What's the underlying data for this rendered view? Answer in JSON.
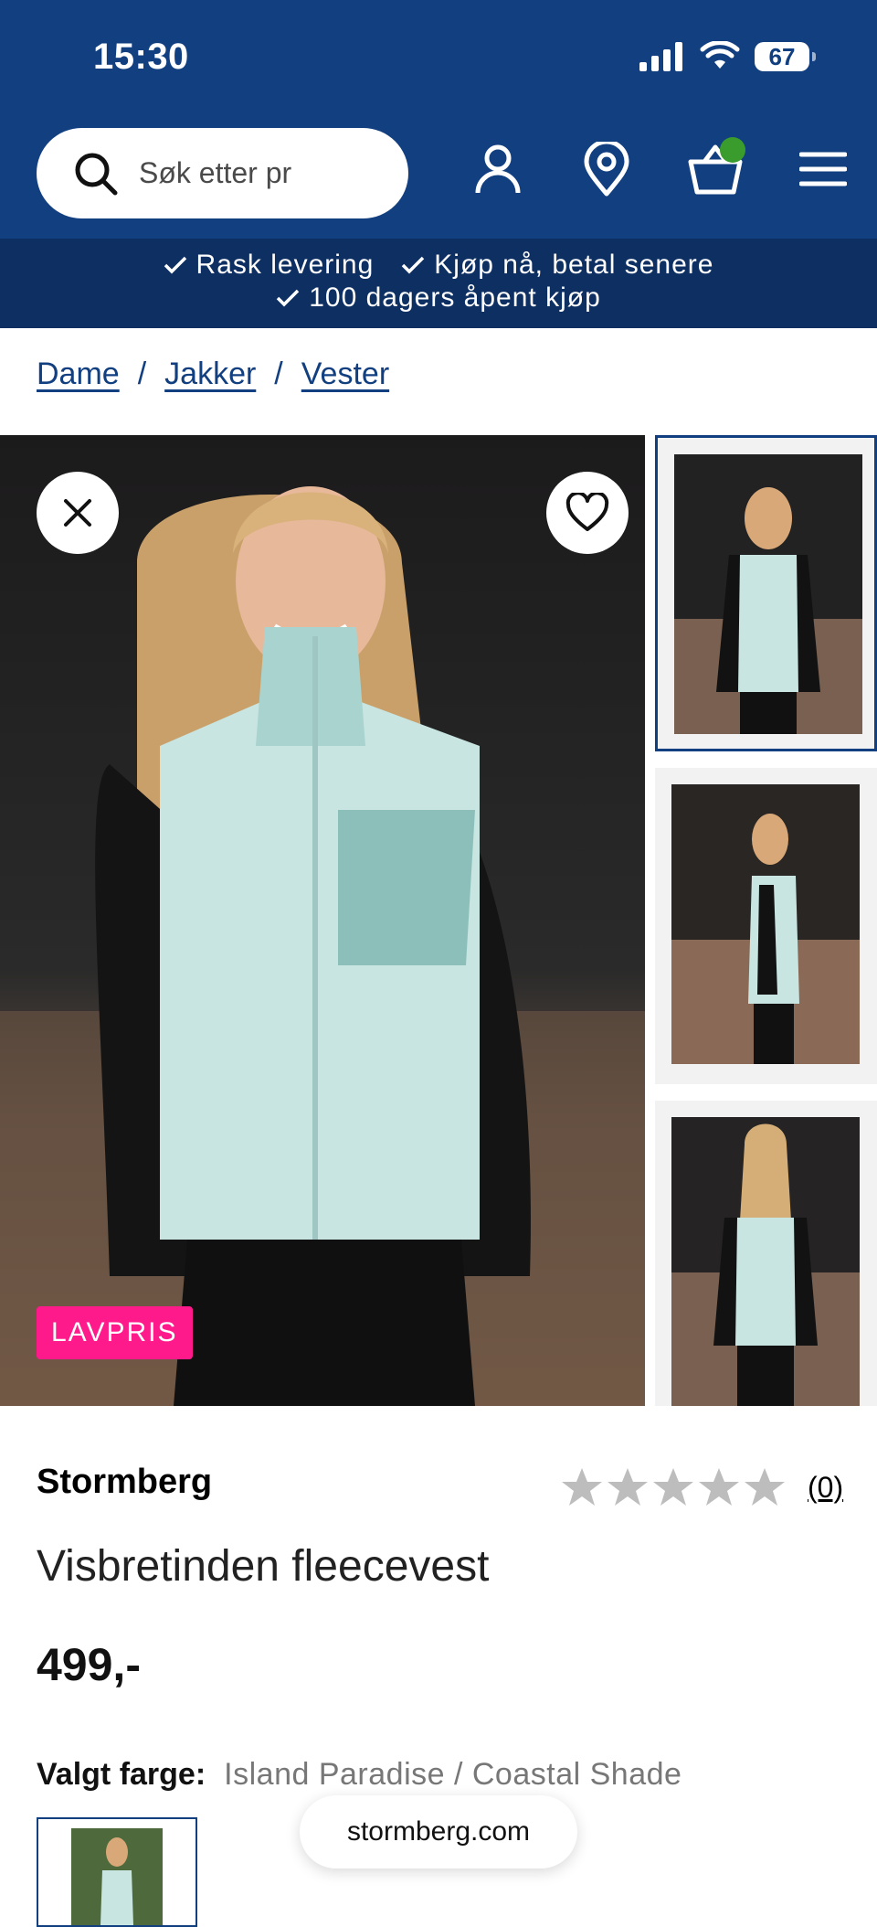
{
  "status_bar": {
    "time": "15:30",
    "battery": "67"
  },
  "search": {
    "placeholder": "Søk etter pr"
  },
  "usp": {
    "items": [
      "Rask levering",
      "Kjøp nå, betal senere",
      "100 dagers åpent kjøp"
    ]
  },
  "breadcrumb": [
    "Dame",
    "Jakker",
    "Vester"
  ],
  "gallery": {
    "badge": "LAVPRIS"
  },
  "product": {
    "brand": "Stormberg",
    "rating_count": "(0)",
    "rating_value": 0,
    "rating_max": 5,
    "name": "Visbretinden fleecevest",
    "price": "499,-",
    "color_label": "Valgt farge:",
    "color_value": "Island Paradise / Coastal Shade"
  },
  "browser": {
    "domain": "stormberg.com"
  },
  "colors": {
    "header": "#123f80",
    "usp_bar": "#0e2f62",
    "badge": "#ff1a8c",
    "cart_dot": "#3a9c2c"
  }
}
